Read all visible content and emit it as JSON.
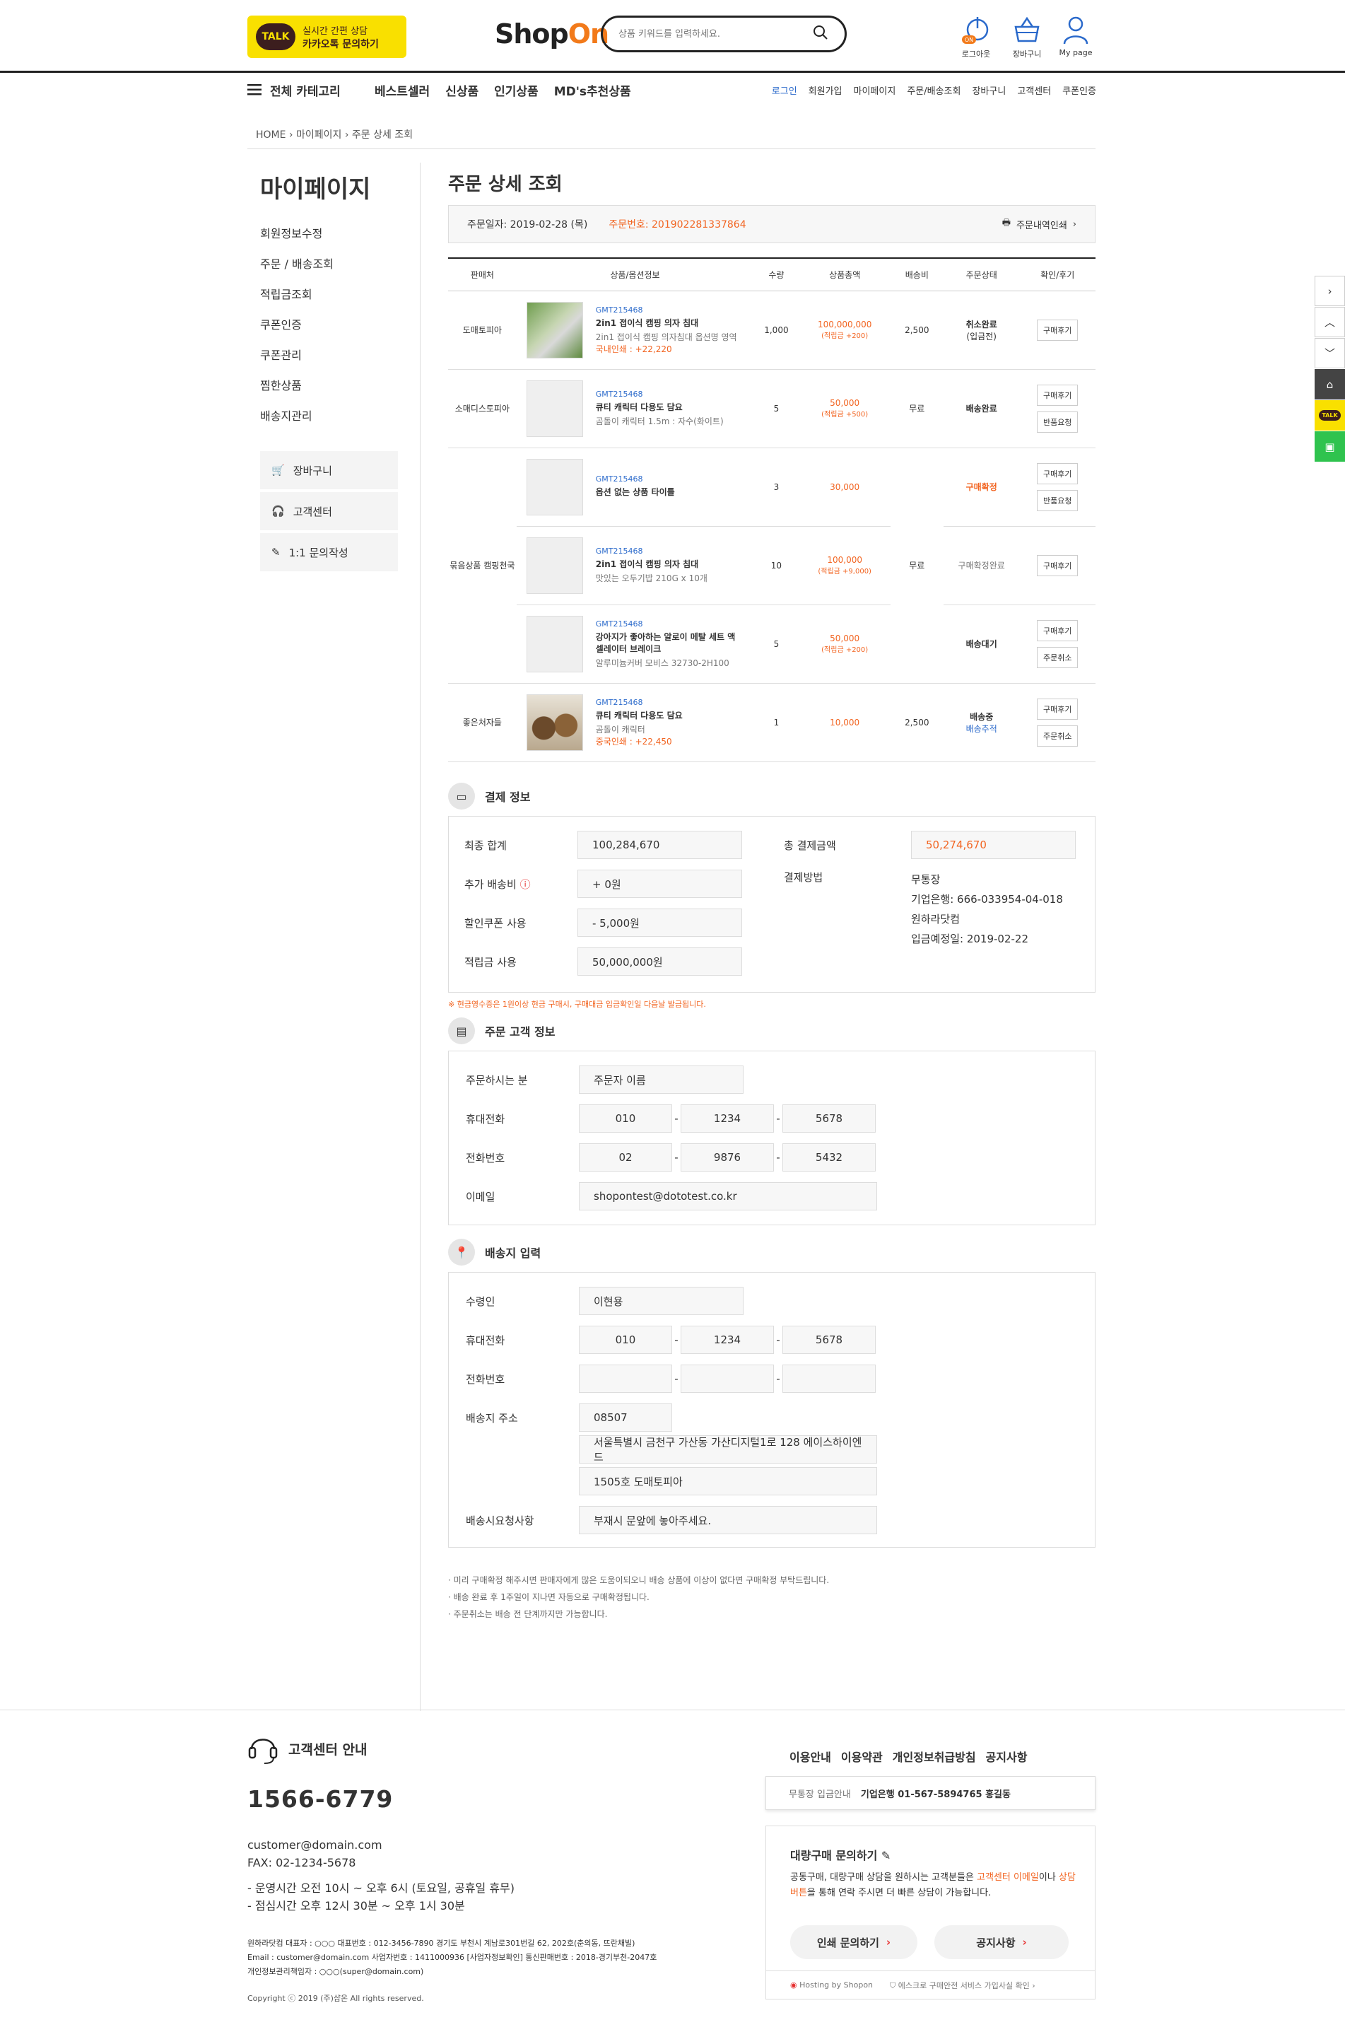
{
  "header": {
    "kakao_line1": "실시간 간편 상담",
    "kakao_line2": "카카오톡 문의하기",
    "kakao_badge": "TALK",
    "logo_main": "Shop",
    "logo_accent": "On",
    "search_placeholder": "상품 키워드를 입력하세요.",
    "icons": [
      {
        "label": "로그아웃",
        "badge": "ON"
      },
      {
        "label": "장바구니"
      },
      {
        "label": "My page"
      }
    ]
  },
  "nav": {
    "category_label": "전체 카테고리",
    "menu": [
      "베스트셀러",
      "신상품",
      "인기상품",
      "MD's추천상품"
    ],
    "util": [
      "로그인",
      "회원가입",
      "마이페이지",
      "주문/배송조회",
      "장바구니",
      "고객센터",
      "쿠폰인증"
    ]
  },
  "breadcrumb": [
    "HOME",
    "마이페이지",
    "주문 상세 조회"
  ],
  "sidebar": {
    "title": "마이페이지",
    "items": [
      "회원정보수정",
      "주문 / 배송조회",
      "적립금조회",
      "쿠폰인증",
      "쿠폰관리",
      "찜한상품",
      "배송지관리"
    ],
    "boxes": [
      "장바구니",
      "고객센터",
      "1:1 문의작성"
    ]
  },
  "page_title": "주문 상세 조회",
  "order_bar": {
    "date_label": "주문일자: 2019-02-28 (목)",
    "number_label": "주문번호: 201902281337864",
    "print_label": "주문내역인쇄"
  },
  "table": {
    "headers": [
      "판매처",
      "상품/옵션정보",
      "수량",
      "상품총액",
      "배송비",
      "주문상태",
      "확인/후기"
    ],
    "rows": [
      {
        "seller": "도매토피아",
        "code": "GMT215468",
        "name": "2in1 접이식 캠핑 의자 침대",
        "opt": "2in1 접이식 캠핑 의자침대 옵션명 영역",
        "point": "국내인쇄 : +22,220",
        "qty": "1,000",
        "price": "100,000,000",
        "reward": "(적립금 +200)",
        "ship": "2,500",
        "status": "취소완료",
        "status2": "(입금전)",
        "btn1": "구매후기",
        "btn2": ""
      },
      {
        "seller": "소매디스토피아",
        "code": "GMT215468",
        "name": "큐티 캐릭터 다용도 담요",
        "opt": "곰돌이 캐릭터 1.5m : 자수(화이트)",
        "point": "",
        "qty": "5",
        "price": "50,000",
        "reward": "(적립금 +500)",
        "ship": "무료",
        "status": "배송완료",
        "status2": "",
        "btn1": "구매후기",
        "btn2": "반품요청"
      },
      {
        "seller": "",
        "code": "GMT215468",
        "name": "옵션 없는 상품 타이틀",
        "opt": "",
        "point": "",
        "qty": "3",
        "price": "30,000",
        "reward": "",
        "ship": "",
        "status": "구매확정",
        "status2": "",
        "btn1": "구매후기",
        "btn2": "반품요청"
      },
      {
        "seller": "묶음상품 캠핑천국",
        "code": "GMT215468",
        "name": "2in1 접이식 캠핑 의자 침대",
        "opt": "맛있는 오두기밥 210G x 10개",
        "point": "",
        "qty": "10",
        "price": "100,000",
        "reward": "(적립금 +9,000)",
        "ship": "무료",
        "status": "구매확정완료",
        "status2": "",
        "btn1": "구매후기",
        "btn2": ""
      },
      {
        "seller": "",
        "code": "GMT215468",
        "name": "강아지가 좋아하는 알로이 메탈 세트 액셀레이터 브레이크",
        "opt": "알루미늄커버 모비스 32730-2H100",
        "point": "",
        "qty": "5",
        "price": "50,000",
        "reward": "(적립금 +200)",
        "ship": "",
        "status": "배송대기",
        "status2": "",
        "btn1": "구매후기",
        "btn2": "주문취소"
      },
      {
        "seller": "좋은처자들",
        "code": "GMT215468",
        "name": "큐티 캐릭터 다용도 담요",
        "opt": "곰돌이 캐릭터",
        "point": "중국인쇄 : +22,450",
        "qty": "1",
        "price": "10,000",
        "reward": "",
        "ship": "2,500",
        "status": "배송중",
        "status2": "배송추적",
        "btn1": "구매후기",
        "btn2": "주문취소"
      }
    ]
  },
  "payment": {
    "title": "결제 정보",
    "final_label": "최종 합계",
    "final_value": "100,284,670",
    "extra_label": "추가 배송비",
    "extra_value": "+ 0원",
    "coupon_label": "할인쿠폰 사용",
    "coupon_value": "- 5,000원",
    "point_label": "적립금 사용",
    "point_value": "50,000,000원",
    "total_label": "총 결제금액",
    "total_value": "50,274,670",
    "method_label": "결제방법",
    "method_lines": [
      "무통장",
      "기업은행: 666-033954-04-018",
      "원하라닷컴",
      "입금예정일: 2019-02-22"
    ],
    "note": "※ 현금영수증은 1원이상 현금 구매시, 구매대금 입금확인일 다음날 발급됩니다."
  },
  "customer": {
    "title": "주문 고객 정보",
    "name_label": "주문하시는 분",
    "name_value": "주문자 이름",
    "mobile_label": "휴대전화",
    "mobile": [
      "010",
      "1234",
      "5678"
    ],
    "phone_label": "전화번호",
    "phone": [
      "02",
      "9876",
      "5432"
    ],
    "email_label": "이메일",
    "email_value": "shopontest@dototest.co.kr"
  },
  "shipping": {
    "title": "배송지 입력",
    "recv_label": "수령인",
    "recv_value": "이현용",
    "mobile_label": "휴대전화",
    "mobile": [
      "010",
      "1234",
      "5678"
    ],
    "phone_label": "전화번호",
    "phone": [
      "",
      "",
      ""
    ],
    "addr_label": "배송지 주소",
    "zip": "08507",
    "addr1": "서울특별시 금천구 가산동 가산디지털1로 128 에이스하이엔드",
    "addr2": "1505호 도매토피아",
    "req_label": "배송시요청사항",
    "req_value": "부재시 문앞에 놓아주세요."
  },
  "notes": [
    "· 미리 구매확정 해주시면 판매자에게 많은 도움이되오니 배송 상품에 이상이 없다면 구매확정 부탁드립니다.",
    "· 배송 완료 후 1주일이 지나면 자동으로 구매확정됩니다.",
    "· 주문취소는 배송 전 단계까지만 가능합니다."
  ],
  "footer": {
    "cs_title": "고객센터 안내",
    "tel": "1566-6779",
    "email": "customer@domain.com",
    "fax": "FAX: 02-1234-5678",
    "hours1": "- 운영시간  오전 10시 ~ 오후 6시 (토요일, 공휴일 휴무)",
    "hours2": "- 점심시간  오후 12시 30분 ~ 오후 1시 30분",
    "company1": "원하라닷컴   대표자 : ○○○   대표번호 : 012-3456-7890   경기도 부천시 계남로301번길 62, 202호(춘의동, 뜨란채빌)",
    "company2": "Email : customer@domain.com   사업자번호 : 1411000936 [사업자정보확인]   통신판매번호 : 2018-경기부천-2047호",
    "company3": "개인정보관리책임자 : ○○○(super@domain.com)",
    "copyright": "Copyright ⓒ 2019 (주)샵온 All rights reserved.",
    "links": [
      "이용안내",
      "이용약관",
      "개인정보취급방침",
      "공지사항"
    ],
    "bank_label": "무통장 입금안내",
    "bank_value": "기업은행 01-567-5894765  홍길동",
    "bulk_title": "대량구매 문의하기",
    "bulk_text_a": "공동구매, 대량구매 상담을 원하시는 고객분들은 ",
    "bulk_text_b": "고객센터 이메일",
    "bulk_text_c": "이나 ",
    "bulk_text_d": "상담 버튼",
    "bulk_text_e": "을 통해 연락 주시면 더 빠른 상담이 가능합니다.",
    "btn_print": "인쇄 문의하기",
    "btn_notice": "공지사항",
    "hosting": "Hosting by Shopon",
    "escrow": "에스크로 구매안전 서비스 가입사실 확인"
  },
  "rail": {
    "talk": "TALK"
  }
}
